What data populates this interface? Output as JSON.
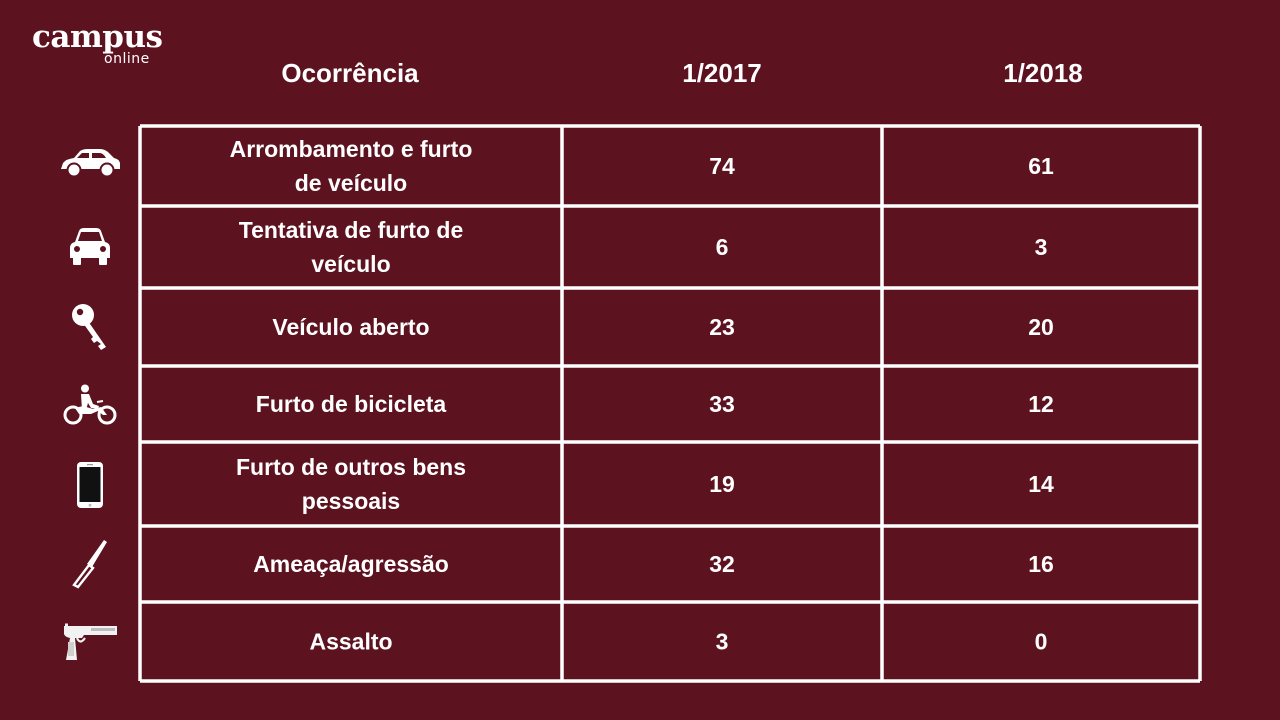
{
  "brand": {
    "name": "campus",
    "sub": "online"
  },
  "chart_data": {
    "type": "table",
    "columns": [
      "Ocorrência",
      "1/2017",
      "1/2018"
    ],
    "rows": [
      {
        "label": [
          "Arrombamento e furto",
          "de veículo"
        ],
        "values": [
          "74",
          "61"
        ],
        "icon": "car-side-icon"
      },
      {
        "label": [
          "Tentativa de furto de",
          "veículo"
        ],
        "values": [
          "6",
          "3"
        ],
        "icon": "car-front-icon"
      },
      {
        "label": [
          "Veículo aberto"
        ],
        "values": [
          "23",
          "20"
        ],
        "icon": "key-icon"
      },
      {
        "label": [
          "Furto de bicicleta"
        ],
        "values": [
          "33",
          "12"
        ],
        "icon": "motorcycle-icon"
      },
      {
        "label": [
          "Furto de outros bens",
          "pessoais"
        ],
        "values": [
          "19",
          "14"
        ],
        "icon": "smartphone-icon"
      },
      {
        "label": [
          "Ameaça/agressão"
        ],
        "values": [
          "32",
          "16"
        ],
        "icon": "knife-icon"
      },
      {
        "label": [
          "Assalto"
        ],
        "values": [
          "3",
          "0"
        ],
        "icon": "pistol-icon"
      }
    ]
  },
  "colors": {
    "background": "#5c121f",
    "lines": "#ffffff",
    "text": "#ffffff"
  }
}
